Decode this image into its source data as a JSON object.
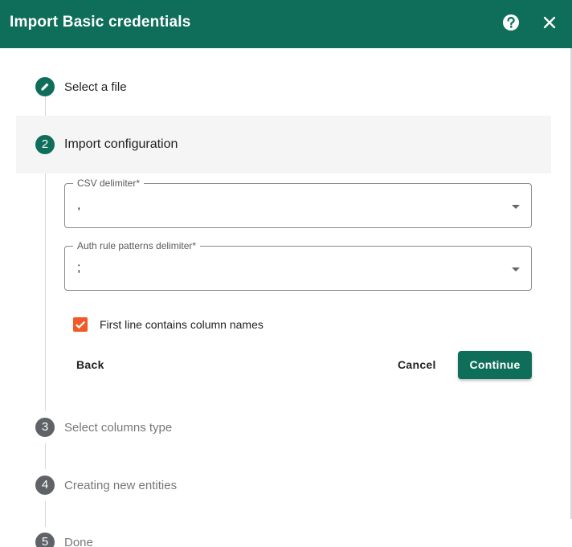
{
  "header": {
    "title": "Import Basic credentials",
    "help_icon": "help-circle-icon",
    "close_icon": "close-icon",
    "background": "#0f6e5a"
  },
  "steps": [
    {
      "number": "1",
      "label": "Select a file",
      "state": "done",
      "icon": "pencil-icon"
    },
    {
      "number": "2",
      "label": "Import configuration",
      "state": "active"
    },
    {
      "number": "3",
      "label": "Select columns type",
      "state": "pending"
    },
    {
      "number": "4",
      "label": "Creating new entities",
      "state": "pending"
    },
    {
      "number": "5",
      "label": "Done",
      "state": "pending"
    }
  ],
  "form": {
    "csv_delimiter": {
      "label": "CSV delimiter*",
      "value": ","
    },
    "auth_rule_delimiter": {
      "label": "Auth rule patterns delimiter*",
      "value": ";"
    },
    "first_line_checkbox": {
      "label": "First line contains column names",
      "checked": true
    },
    "buttons": {
      "back": "Back",
      "cancel": "Cancel",
      "continue": "Continue"
    }
  },
  "colors": {
    "accent": "#0f6e5a",
    "checkbox": "#f05a28",
    "pending_step": "#5f6368"
  }
}
